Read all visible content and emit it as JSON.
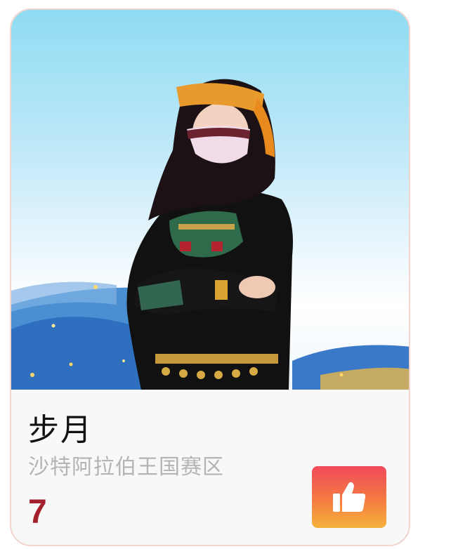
{
  "contestant": {
    "name": "步月",
    "region": "沙特阿拉伯王国赛区",
    "votes": "7"
  },
  "icons": {
    "like": "thumbs-up-icon"
  },
  "colors": {
    "card_border": "#f2d4cf",
    "votes": "#a5202d",
    "button_gradient_top": "#f14a5c",
    "button_gradient_bottom": "#f6b23c"
  }
}
